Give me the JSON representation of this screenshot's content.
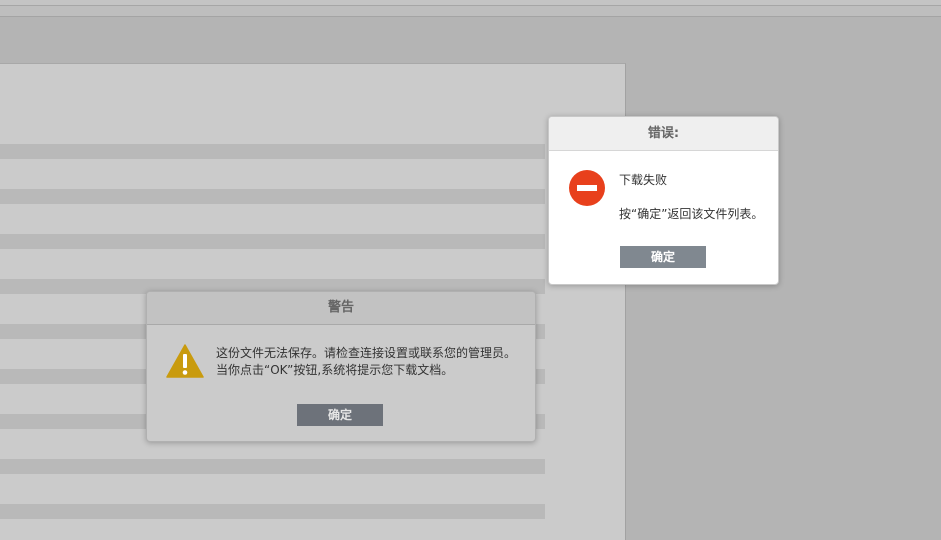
{
  "error_dialog": {
    "title": "错误:",
    "icon": "no-entry-icon",
    "heading": "下载失败",
    "message": "按“确定”返回该文件列表。",
    "ok_label": "确定"
  },
  "warning_dialog": {
    "title": "警告",
    "icon": "warning-triangle-icon",
    "message_line1": "这份文件无法保存。请检查连接设置或联系您的管理员。",
    "message_line2": "当你点击“OK”按钮,系统将提示您下载文档。",
    "ok_label": "确定"
  },
  "colors": {
    "error_red": "#e8401c",
    "warning_amber": "#c99b0e",
    "button_gray": "#808890",
    "backdrop_gray": "#b4b4b4"
  }
}
